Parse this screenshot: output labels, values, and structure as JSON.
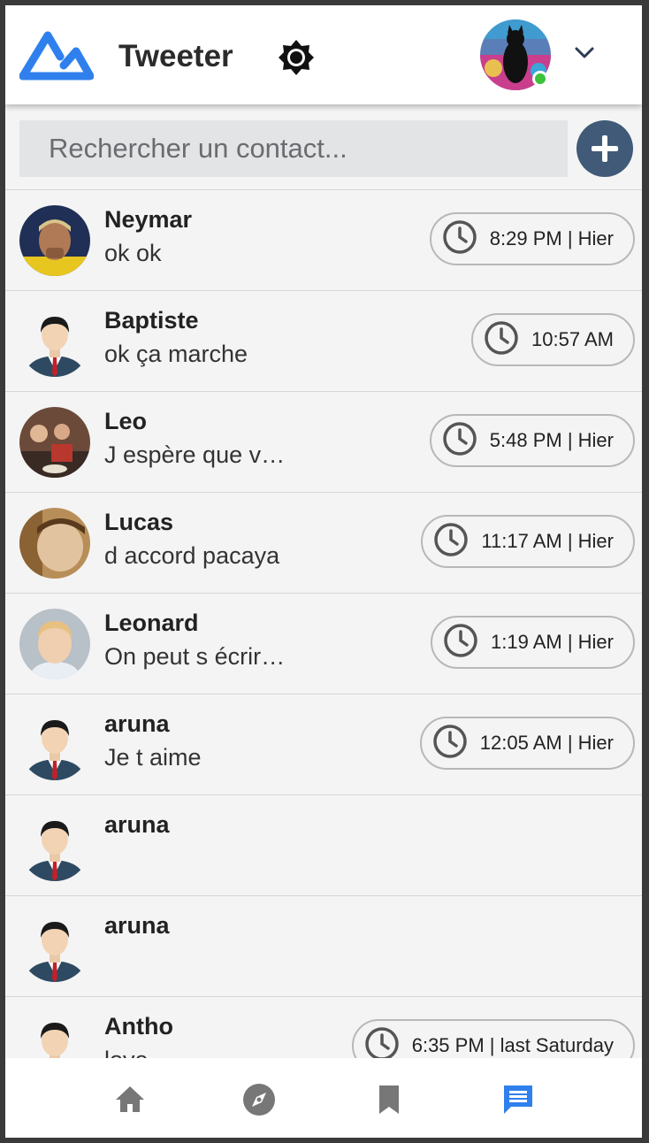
{
  "header": {
    "app_title": "Tweeter",
    "logo_icon": "mountain-logo-icon",
    "theme_icon": "brightness-icon",
    "menu_icon": "chevron-down-icon",
    "user_online": true
  },
  "search": {
    "placeholder": "Rechercher un contact...",
    "value": ""
  },
  "add_button": {
    "icon": "plus-icon"
  },
  "conversations": [
    {
      "name": "Neymar",
      "message": "ok ok",
      "time": "8:29 PM | Hier"
    },
    {
      "name": "Baptiste",
      "message": "ok ça marche",
      "time": "10:57 AM"
    },
    {
      "name": "Leo",
      "message": "J espère que v…",
      "time": "5:48 PM | Hier"
    },
    {
      "name": "Lucas",
      "message": "d accord pacaya",
      "time": "11:17 AM | Hier"
    },
    {
      "name": "Leonard",
      "message": "On peut s écrir…",
      "time": "1:19 AM | Hier"
    },
    {
      "name": "aruna",
      "message": "Je t aime",
      "time": "12:05 AM | Hier"
    },
    {
      "name": "aruna",
      "message": "",
      "time": ""
    },
    {
      "name": "aruna",
      "message": "",
      "time": ""
    },
    {
      "name": "Antho",
      "message": "love",
      "time": "6:35 PM | last Saturday"
    }
  ],
  "bottom_nav": [
    {
      "icon": "home-icon",
      "active": false
    },
    {
      "icon": "compass-icon",
      "active": false
    },
    {
      "icon": "bookmark-icon",
      "active": false
    },
    {
      "icon": "chat-icon",
      "active": true
    }
  ],
  "colors": {
    "accent": "#2f80ed",
    "nav_inactive": "#777777",
    "add_button": "#405a78",
    "online": "#3cc13b"
  }
}
